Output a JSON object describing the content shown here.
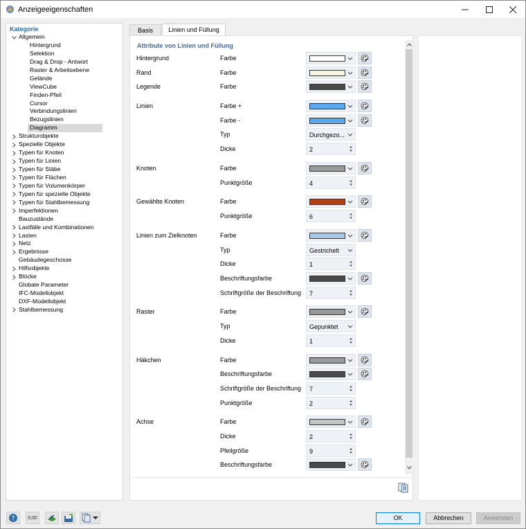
{
  "window": {
    "title": "Anzeigeeigenschaften"
  },
  "tree": {
    "header": "Kategorie",
    "items": [
      {
        "label": "Allgemein",
        "level": 0,
        "arrow": "expanded"
      },
      {
        "label": "Hintergrund",
        "level": 1,
        "arrow": "none"
      },
      {
        "label": "Selektion",
        "level": 1,
        "arrow": "none"
      },
      {
        "label": "Drag & Drop - Antwort",
        "level": 1,
        "arrow": "none"
      },
      {
        "label": "Raster & Arbeitsebene",
        "level": 1,
        "arrow": "none"
      },
      {
        "label": "Gelände",
        "level": 1,
        "arrow": "none"
      },
      {
        "label": "ViewCube",
        "level": 1,
        "arrow": "none"
      },
      {
        "label": "Finden-Pfeil",
        "level": 1,
        "arrow": "none"
      },
      {
        "label": "Cursor",
        "level": 1,
        "arrow": "none"
      },
      {
        "label": "Verbindungslinien",
        "level": 1,
        "arrow": "none"
      },
      {
        "label": "Bezugslinien",
        "level": 1,
        "arrow": "none"
      },
      {
        "label": "Diagramm",
        "level": 1,
        "arrow": "none",
        "selected": true
      },
      {
        "label": "Strukturobjekte",
        "level": 0,
        "arrow": "collapsed"
      },
      {
        "label": "Spezielle Objekte",
        "level": 0,
        "arrow": "collapsed"
      },
      {
        "label": "Typen für Knoten",
        "level": 0,
        "arrow": "collapsed"
      },
      {
        "label": "Typen für Linien",
        "level": 0,
        "arrow": "collapsed"
      },
      {
        "label": "Typen für Stäbe",
        "level": 0,
        "arrow": "collapsed"
      },
      {
        "label": "Typen für Flächen",
        "level": 0,
        "arrow": "collapsed"
      },
      {
        "label": "Typen für Volumenkörper",
        "level": 0,
        "arrow": "collapsed"
      },
      {
        "label": "Typen für spezielle Objekte",
        "level": 0,
        "arrow": "collapsed"
      },
      {
        "label": "Typen für Stahlbemessung",
        "level": 0,
        "arrow": "collapsed"
      },
      {
        "label": "Imperfektionen",
        "level": 0,
        "arrow": "collapsed"
      },
      {
        "label": "Bauzustände",
        "level": 0,
        "arrow": "none"
      },
      {
        "label": "Lastfälle und Kombinationen",
        "level": 0,
        "arrow": "collapsed"
      },
      {
        "label": "Lasten",
        "level": 0,
        "arrow": "collapsed"
      },
      {
        "label": "Netz",
        "level": 0,
        "arrow": "collapsed"
      },
      {
        "label": "Ergebnisse",
        "level": 0,
        "arrow": "collapsed"
      },
      {
        "label": "Gebäudegeschosse",
        "level": 0,
        "arrow": "none"
      },
      {
        "label": "Hilfsobjekte",
        "level": 0,
        "arrow": "collapsed"
      },
      {
        "label": "Blöcke",
        "level": 0,
        "arrow": "collapsed"
      },
      {
        "label": "Globale Parameter",
        "level": 0,
        "arrow": "none"
      },
      {
        "label": "IFC-Modellobjekt",
        "level": 0,
        "arrow": "none"
      },
      {
        "label": "DXF-Modellobjekt",
        "level": 0,
        "arrow": "none"
      },
      {
        "label": "Stahlbemessung",
        "level": 0,
        "arrow": "collapsed"
      }
    ]
  },
  "tabs": [
    {
      "label": "Basis",
      "active": false
    },
    {
      "label": "Linien und Füllung",
      "active": true
    }
  ],
  "panel": {
    "title": "Attribute von Linien und Füllung",
    "rows": [
      {
        "category": "Hintergrund",
        "name": "Farbe",
        "kind": "color",
        "color": "#ffffff"
      },
      {
        "category": "Rand",
        "name": "Farbe",
        "kind": "color",
        "color": "#f7f5e6"
      },
      {
        "category": "Legende",
        "name": "Farbe",
        "kind": "color",
        "color": "#4a4a4a"
      },
      {
        "category": "Linien",
        "name": "Farbe +",
        "kind": "color",
        "color": "#5aa8f0",
        "gap": true
      },
      {
        "category": "",
        "name": "Farbe -",
        "kind": "color",
        "color": "#5aa8f0"
      },
      {
        "category": "",
        "name": "Typ",
        "kind": "select",
        "value": "Durchgezo..."
      },
      {
        "category": "",
        "name": "Dicke",
        "kind": "spin",
        "value": "2"
      },
      {
        "category": "Knoten",
        "name": "Farbe",
        "kind": "color",
        "color": "#9a9a9a",
        "gap": true
      },
      {
        "category": "",
        "name": "Punktgröße",
        "kind": "spin",
        "value": "4"
      },
      {
        "category": "Gewählte Knoten",
        "name": "Farbe",
        "kind": "color",
        "color": "#b0421a",
        "gap": true
      },
      {
        "category": "",
        "name": "Punktgröße",
        "kind": "spin",
        "value": "6"
      },
      {
        "category": "Linien zum Zielknoten",
        "name": "Farbe",
        "kind": "color",
        "color": "#a8c8ea",
        "gap": true
      },
      {
        "category": "",
        "name": "Typ",
        "kind": "select",
        "value": "Gestrichelt"
      },
      {
        "category": "",
        "name": "Dicke",
        "kind": "spin",
        "value": "1"
      },
      {
        "category": "",
        "name": "Beschriftungsfarbe",
        "kind": "color",
        "color": "#4a4a4a"
      },
      {
        "category": "",
        "name": "Schriftgröße der Beschriftung",
        "kind": "spin",
        "value": "7"
      },
      {
        "category": "Raster",
        "name": "Farbe",
        "kind": "color",
        "color": "#9a9a9a",
        "gap": true
      },
      {
        "category": "",
        "name": "Typ",
        "kind": "select",
        "value": "Gepunktet"
      },
      {
        "category": "",
        "name": "Dicke",
        "kind": "spin",
        "value": "1"
      },
      {
        "category": "Häkchen",
        "name": "Farbe",
        "kind": "color",
        "color": "#9a9a9a",
        "gap": true
      },
      {
        "category": "",
        "name": "Beschriftungsfarbe",
        "kind": "color",
        "color": "#4a4a4a"
      },
      {
        "category": "",
        "name": "Schriftgröße der Beschriftung",
        "kind": "spin",
        "value": "7"
      },
      {
        "category": "",
        "name": "Punktgröße",
        "kind": "spin",
        "value": "2"
      },
      {
        "category": "Achse",
        "name": "Farbe",
        "kind": "color",
        "color": "#c4c4c4",
        "gap": true
      },
      {
        "category": "",
        "name": "Dicke",
        "kind": "spin",
        "value": "2"
      },
      {
        "category": "",
        "name": "Pfeilgröße",
        "kind": "spin",
        "value": "9"
      },
      {
        "category": "",
        "name": "Beschriftungsfarbe",
        "kind": "color",
        "color": "#4a4a4a"
      }
    ]
  },
  "buttons": {
    "ok": "OK",
    "cancel": "Abbrechen",
    "apply": "Anwenden"
  },
  "footer_icons": [
    "help-icon",
    "units-icon",
    "model-icon",
    "save-settings-icon",
    "copy-menu-icon"
  ],
  "footer_units_label": "0,00"
}
